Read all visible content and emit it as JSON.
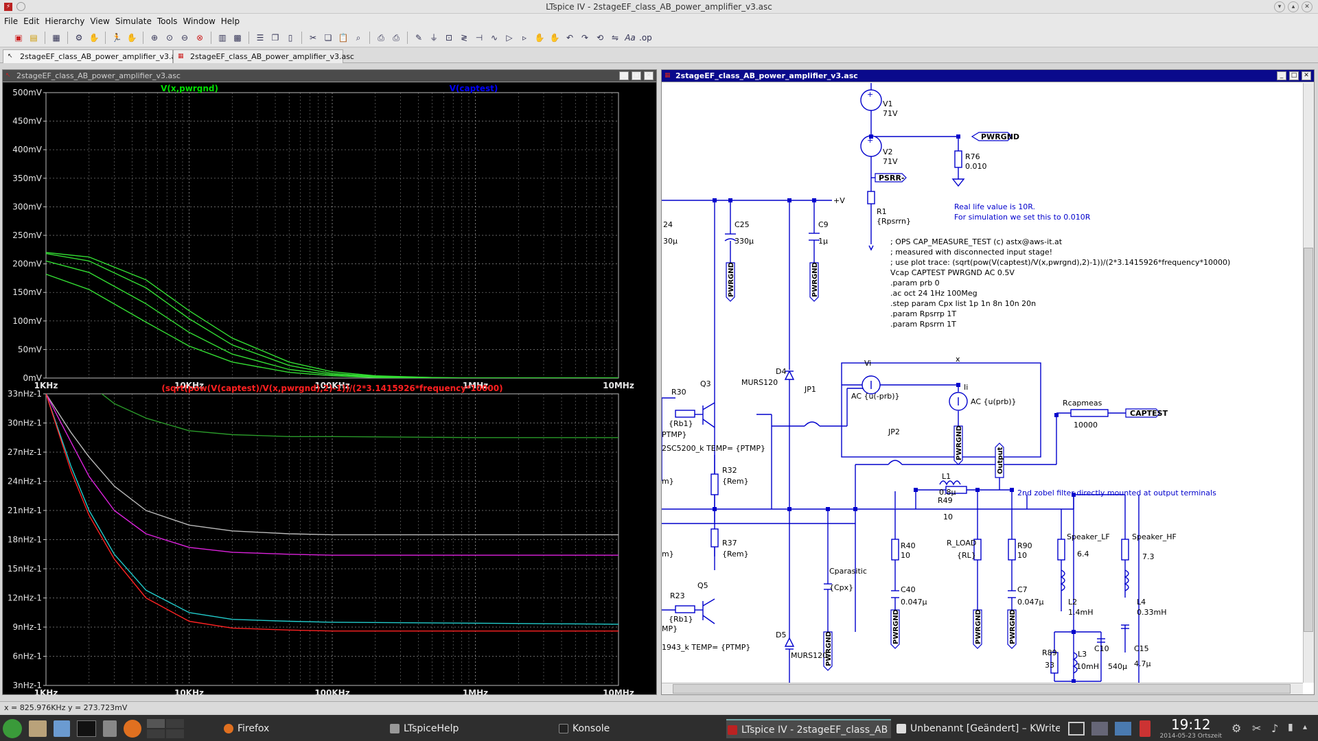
{
  "window": {
    "title": "LTspice IV - 2stageEF_class_AB_power_amplifier_v3.asc"
  },
  "menu": [
    "File",
    "Edit",
    "Hierarchy",
    "View",
    "Simulate",
    "Tools",
    "Window",
    "Help"
  ],
  "tabs": [
    "2stageEF_class_AB_power_amplifier_v3.asc",
    "2stageEF_class_AB_power_amplifier_v3.asc"
  ],
  "waveform_window": {
    "title": "2stageEF_class_AB_power_amplifier_v3.asc"
  },
  "schematic_window": {
    "title": "2stageEF_class_AB_power_amplifier_v3.asc"
  },
  "chart_data": [
    {
      "type": "line",
      "trace_labels": [
        "V(x,pwrgnd)",
        "V(captest)"
      ],
      "trace_colors": [
        "#00e000",
        "#0000ff"
      ],
      "x_scale": "log",
      "xlim": [
        1000,
        10000000
      ],
      "x_tick_labels": [
        "1KHz",
        "10KHz",
        "100KHz",
        "1MHz",
        "10MHz"
      ],
      "ylim": [
        0,
        500
      ],
      "y_tick_labels": [
        "500mV",
        "450mV",
        "400mV",
        "350mV",
        "300mV",
        "250mV",
        "200mV",
        "150mV",
        "100mV",
        "50mV",
        "0mV"
      ],
      "x": [
        1000,
        2000,
        5000,
        10000,
        20000,
        50000,
        100000,
        200000,
        500000,
        1000000,
        10000000
      ],
      "series": [
        {
          "color": "#33dd33",
          "values": [
            220,
            212,
            172,
            118,
            70,
            28,
            11,
            4,
            1,
            0,
            0
          ]
        },
        {
          "color": "#33dd33",
          "values": [
            218,
            205,
            158,
            104,
            58,
            22,
            8,
            3,
            1,
            0,
            0
          ]
        },
        {
          "color": "#33dd33",
          "values": [
            205,
            185,
            130,
            80,
            42,
            15,
            6,
            2,
            0,
            0,
            0
          ]
        },
        {
          "color": "#33dd33",
          "values": [
            182,
            155,
            98,
            56,
            28,
            10,
            4,
            1,
            0,
            0,
            0
          ]
        }
      ]
    },
    {
      "type": "line",
      "title": "(sqrt(pow(V(captest)/V(x,pwrgnd),2)-1))/(2*3.1415926*frequency*10000)",
      "title_color": "#ff2020",
      "x_scale": "log",
      "xlim": [
        1000,
        10000000
      ],
      "x_tick_labels": [
        "1KHz",
        "10KHz",
        "100KHz",
        "1MHz",
        "10MHz"
      ],
      "ylim": [
        3,
        33
      ],
      "y_tick_labels": [
        "33nHz-1",
        "30nHz-1",
        "27nHz-1",
        "24nHz-1",
        "21nHz-1",
        "18nHz-1",
        "15nHz-1",
        "12nHz-1",
        "9nHz-1",
        "6nHz-1",
        "3nHz-1"
      ],
      "x": [
        1000,
        1500,
        2000,
        3000,
        5000,
        10000,
        20000,
        50000,
        100000,
        1000000,
        10000000
      ],
      "series": [
        {
          "color": "#2a9a2a",
          "values": [
            38,
            36,
            34,
            32,
            30.5,
            29.2,
            28.8,
            28.6,
            28.6,
            28.5,
            28.5
          ]
        },
        {
          "color": "#bbbbbb",
          "values": [
            33,
            29,
            26.5,
            23.5,
            21,
            19.5,
            18.9,
            18.6,
            18.5,
            18.5,
            18.5
          ]
        },
        {
          "color": "#dd22dd",
          "values": [
            33,
            28,
            24.5,
            21,
            18.6,
            17.2,
            16.7,
            16.5,
            16.4,
            16.4,
            16.4
          ]
        },
        {
          "color": "#22cccc",
          "values": [
            33,
            25.5,
            21,
            16.5,
            12.8,
            10.5,
            9.8,
            9.6,
            9.5,
            9.4,
            9.3
          ]
        },
        {
          "color": "#ff2222",
          "values": [
            33,
            25,
            20.5,
            16,
            12,
            9.6,
            8.9,
            8.7,
            8.6,
            8.6,
            8.6
          ]
        }
      ]
    }
  ],
  "schematic": {
    "labels": {
      "v1": "V1",
      "v1v": "71V",
      "v2": "V2",
      "v2v": "71V",
      "pwrgnd": "PWRGND",
      "r76": "R76",
      "r76v": "0.010",
      "psrr": "PSRR-",
      "r1": "R1",
      "r1v": "{Rpsrrn}",
      "vplus": "+V",
      "n24": "24",
      "n30u": "30µ",
      "c25": "C25",
      "c25v": "330µ",
      "c9": "C9",
      "c9v": "1µ",
      "pw1": "PWRGND",
      "pw2": "PWRGND",
      "pw3": "PWRGND",
      "pw4": "PWRGND",
      "pw5": "PWRGND",
      "pw6": "PWRGND",
      "pw7": "PWRGND",
      "d4": "D4",
      "d4v": "MURS120",
      "d5": "D5",
      "d5v": "MURS120",
      "jp1": "JP1",
      "jp2": "JP2",
      "r30": "R30",
      "r30v": "{Rb1}",
      "q3": "Q3",
      "ptmp1": "PTMP}",
      "q3m": "2SC5200_k TEMP= {PTMP}",
      "r32": "R32",
      "r32v": "{Rem}",
      "r37": "R37",
      "r37v": "{Rem}",
      "q5": "Q5",
      "r23": "R23",
      "r23v": "{Rb1}",
      "ptmp2": "MP}",
      "q5m": "1943_k TEMP= {PTMP}",
      "m1": "m}",
      "m2": "m}",
      "vi": "Vi",
      "viv": "AC {u(-prb)}",
      "ii": "Ii",
      "iiv": "AC {u(prb)}",
      "xnode": "x",
      "rcap": "Rcapmeas",
      "rcapv": "10000",
      "captest": "CAPTEST",
      "cpar": "Cparasitic",
      "cparv": "{Cpx}",
      "l1": "L1",
      "l1v": "0.8µ",
      "r49": "R49",
      "r49v": "10",
      "output": "Output",
      "r40": "R40",
      "r40v": "10",
      "c40": "C40",
      "c40v": "0.047µ",
      "rload": "R_LOAD",
      "rloadv": "{RL}",
      "r90": "R90",
      "r90v": "10",
      "c7": "C7",
      "c7v": "0.047µ",
      "spklf": "Speaker_LF",
      "spklfv": "6.4",
      "spkhf": "Speaker_HF",
      "spkhfv": "7.3",
      "l2": "L2",
      "l2v": "1.4mH",
      "l4": "L4",
      "l4v": "0.33mH",
      "r89": "R89",
      "r89v": "33",
      "l3": "L3",
      "l3v": "10mH",
      "c10": "C10",
      "c10v": "540µ",
      "c15": "C15",
      "c15v": "4.7µ"
    },
    "note_real_life": [
      "Real life value is 10R.",
      "For simulation we set this to 0.010R"
    ],
    "note_zobel": "2nd zobel filter directly mounted at output terminals",
    "directives": [
      "; OPS CAP_MEASURE_TEST (c) astx@aws-it.at",
      "; measured with disconnected input stage!",
      "; use plot trace:  (sqrt(pow(V(captest)/V(x,pwrgnd),2)-1))/(2*3.1415926*frequency*10000)",
      "Vcap CAPTEST PWRGND AC 0.5V",
      ".param prb 0",
      ".ac oct 24 1Hz 100Meg",
      ".step param Cpx list 1p 1n 8n 10n 20n",
      ".param Rpsrrp 1T",
      ".param Rpsrrn 1T"
    ]
  },
  "status": "x = 825.976KHz    y = 273.723mV",
  "taskbar": {
    "items": [
      "Firefox",
      "LTspiceHelp",
      "Konsole",
      "LTspice IV - 2stageEF_class_AB",
      "Unbenannt [Geändert] – KWrite"
    ],
    "time": "19:12",
    "date": "2014-05-23 Ortszeit"
  }
}
